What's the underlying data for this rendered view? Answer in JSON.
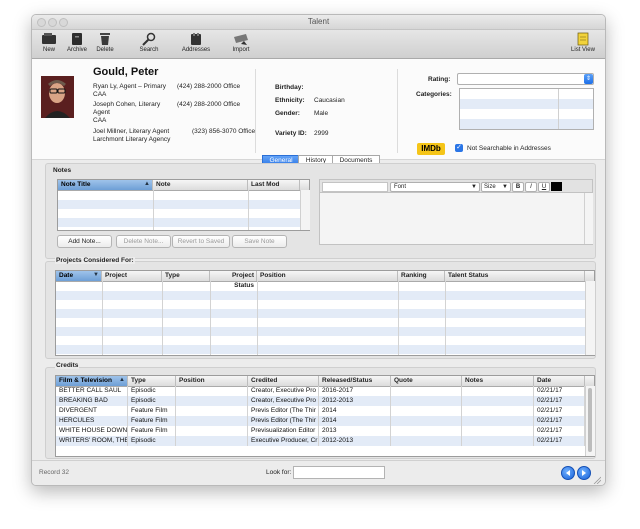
{
  "window": {
    "title": "Talent"
  },
  "toolbar": {
    "new": "New",
    "archive": "Archive",
    "delete": "Delete",
    "search": "Search",
    "addresses": "Addresses",
    "import": "Import",
    "list_view": "List View"
  },
  "person": {
    "name": "Gould, Peter",
    "agents": [
      {
        "line1": "Ryan Ly, Agent – Primary",
        "line2": "CAA",
        "phone": "(424) 288-2000 Office"
      },
      {
        "line1": "Joseph Cohen, Literary",
        "line2": "Agent",
        "line3": "CAA",
        "phone": "(424) 288-2000 Office"
      },
      {
        "line1": "Joel Millner, Literary Agent",
        "line2": "Larchmont Literary Agency",
        "phone": "(323) 856-3070 Office"
      }
    ],
    "birthday_label": "Birthday:",
    "birthday": "",
    "ethnicity_label": "Ethnicity:",
    "ethnicity": "Caucasian",
    "gender_label": "Gender:",
    "gender": "Male",
    "variety_label": "Variety ID:",
    "variety_id": "2999",
    "rating_label": "Rating:",
    "categories_label": "Categories:",
    "imdb": "IMDb",
    "not_searchable": "Not Searchable in Addresses"
  },
  "tabs": [
    "General",
    "History",
    "Documents"
  ],
  "notes": {
    "title": "Notes",
    "columns": [
      "Note Title",
      "Note",
      "Last Mod"
    ],
    "font_label": "Font",
    "size_label": "Size",
    "bold": "B",
    "italic": "I",
    "underline": "U",
    "buttons": {
      "add": "Add Note...",
      "delete": "Delete Note...",
      "revert": "Revert to Saved",
      "save": "Save Note"
    }
  },
  "projects": {
    "title": "Projects Considered For:",
    "columns": [
      "Date",
      "Project",
      "Type",
      "Project Status",
      "Position",
      "Ranking",
      "Talent Status"
    ]
  },
  "credits": {
    "title": "Credits",
    "columns": [
      "Film & Television",
      "Type",
      "Position",
      "Credited",
      "Released/Status",
      "Quote",
      "Notes",
      "Date"
    ],
    "rows": [
      [
        "BETTER CALL SAUL",
        "Episodic",
        "",
        "Creator, Executive Pro",
        "2016-2017",
        "",
        "",
        "02/21/17"
      ],
      [
        "BREAKING BAD",
        "Episodic",
        "",
        "Creator, Executive Pro",
        "2012-2013",
        "",
        "",
        "02/21/17"
      ],
      [
        "DIVERGENT",
        "Feature Film",
        "",
        "Previs Editor (The Thir",
        "2014",
        "",
        "",
        "02/21/17"
      ],
      [
        "HERCULES",
        "Feature Film",
        "",
        "Previs Editor (The Thir",
        "2014",
        "",
        "",
        "02/21/17"
      ],
      [
        "WHITE HOUSE DOWN",
        "Feature Film",
        "",
        "Previsualization Editor",
        "2013",
        "",
        "",
        "02/21/17"
      ],
      [
        "WRITERS' ROOM, THE",
        "Episodic",
        "",
        "Executive Producer, Cr",
        "2012-2013",
        "",
        "",
        "02/21/17"
      ]
    ]
  },
  "status": {
    "record": "Record 32",
    "look_for": "Look for:"
  }
}
